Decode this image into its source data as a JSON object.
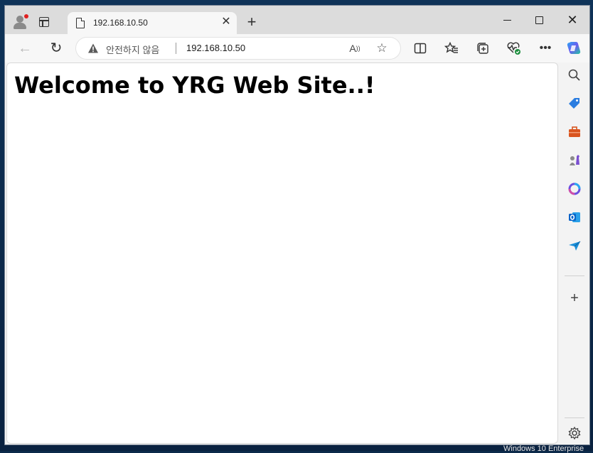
{
  "tab": {
    "title": "192.168.10.50"
  },
  "toolbar": {
    "security_label": "안전하지 않음",
    "url": "192.168.10.50"
  },
  "page": {
    "heading": "Welcome to YRG Web Site..!"
  },
  "os": {
    "watermark": "Windows 10 Enterprise"
  },
  "icons": {
    "profile": "profile-avatar-icon",
    "tab_actions": "tab-actions-icon",
    "page": "page-icon",
    "close_tab": "close-icon",
    "new_tab": "plus-icon",
    "back": "arrow-left-icon",
    "refresh": "refresh-icon",
    "warning": "warning-icon",
    "read_aloud": "read-aloud-icon",
    "favorite": "star-icon",
    "split_screen": "split-screen-icon",
    "favorites": "favorites-icon",
    "collections": "collections-icon",
    "browser_essentials": "heartbeat-icon",
    "more": "more-icon",
    "copilot": "copilot-icon",
    "search": "search-icon",
    "shopping": "tag-icon",
    "tools": "toolbox-icon",
    "games": "chess-icon",
    "microsoft365": "m365-icon",
    "outlook": "outlook-icon",
    "drop": "send-icon",
    "add": "plus-icon",
    "settings": "gear-icon"
  },
  "colors": {
    "desktop": "#0c2a4a",
    "tabstrip": "#dcdcdc",
    "warning": "#555555",
    "outlook": "#0a64c8",
    "shopping": "#2b7de0",
    "tools": "#d9541e"
  }
}
